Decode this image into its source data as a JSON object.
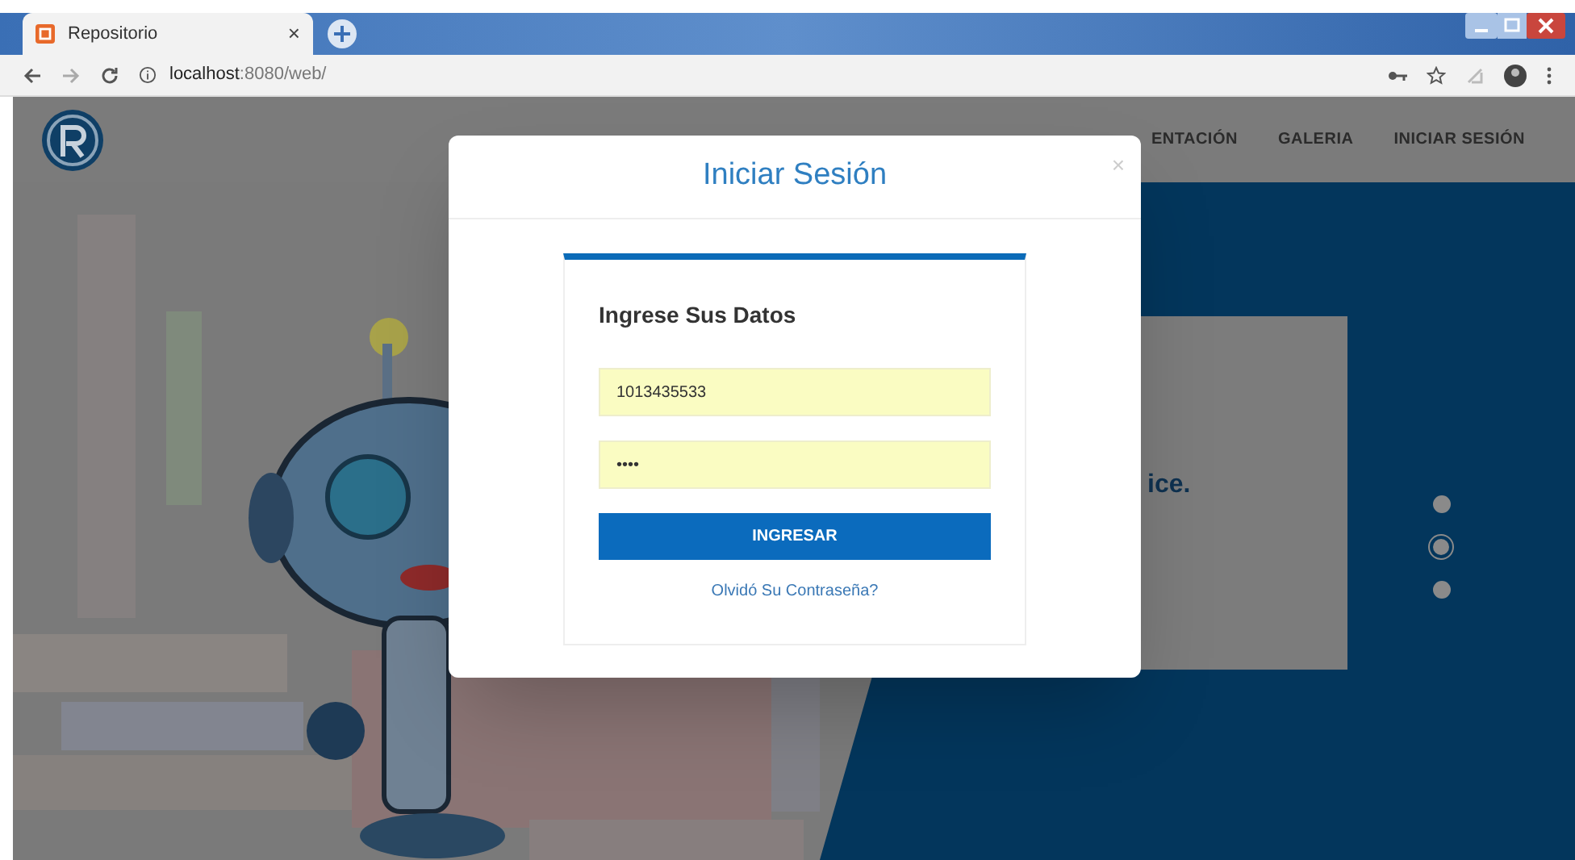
{
  "browser": {
    "tab": {
      "title": "Repositorio",
      "close": "×"
    },
    "address": {
      "host": "localhost",
      "path": ":8080/web/"
    }
  },
  "nav": {
    "items": [
      {
        "label": "ENTACIÓN"
      },
      {
        "label": "GALERIA"
      },
      {
        "label": "INICIAR SESIÓN"
      }
    ]
  },
  "hero": {
    "caption": "ice.",
    "dots": [
      {
        "selected": false
      },
      {
        "selected": true
      },
      {
        "selected": false
      }
    ]
  },
  "modal": {
    "title": "Iniciar Sesión",
    "close": "×",
    "card": {
      "heading": "Ingrese Sus Datos",
      "fields": [
        {
          "value": "1013435533"
        },
        {
          "value": "••••"
        }
      ],
      "button": "INGRESAR",
      "link": "Olvidó Su Contraseña?"
    }
  }
}
